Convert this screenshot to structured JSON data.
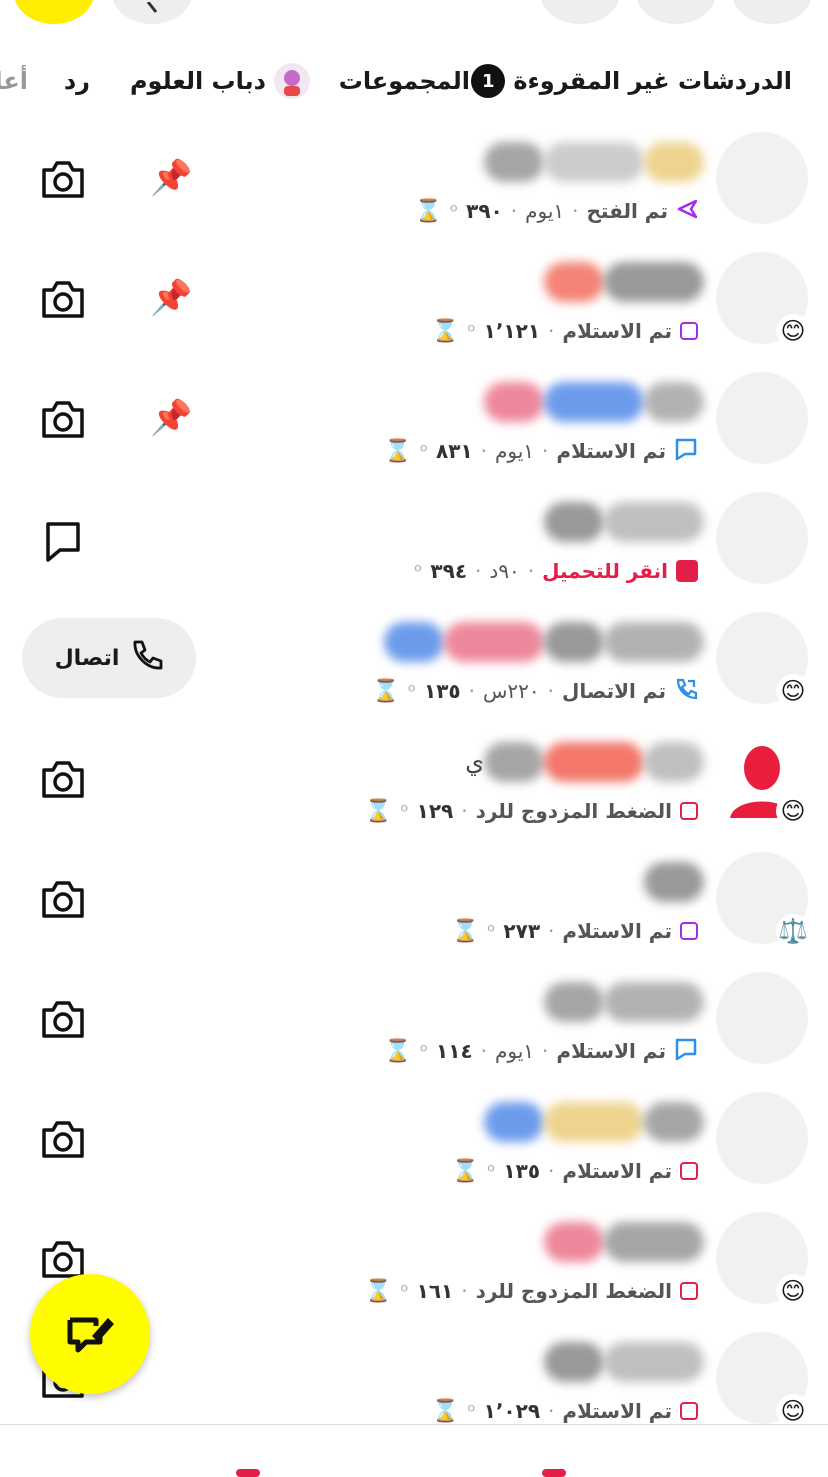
{
  "tabs": [
    {
      "label": "الدردشات غير المقروءة",
      "badge": "1"
    },
    {
      "label": "المجموعات"
    },
    {
      "label": "دباب العلوم"
    },
    {
      "label": "رد"
    },
    {
      "label": "أعا"
    }
  ],
  "chats": [
    {
      "name": "",
      "status": "تم الفتح",
      "status_icon": "sent-arrow-icon",
      "status_color": "#a12ee8",
      "time": "١يوم",
      "streak": "٣٩٠",
      "hourglass": true,
      "emoji": "",
      "action": "camera",
      "pinned": true,
      "blobs": [
        "#888",
        "#bbb",
        "#e9c56a"
      ]
    },
    {
      "name": "",
      "status": "تم الاستلام",
      "status_icon": "square-icon",
      "status_color": "#a12ee8",
      "time": "",
      "streak": "١٬١٢١",
      "hourglass": true,
      "emoji": "😊",
      "action": "camera",
      "pinned": true,
      "blobs": [
        "#ef5a48",
        "#777"
      ]
    },
    {
      "name": "",
      "status": "تم الاستلام",
      "status_icon": "chat-bubble-icon",
      "status_color": "#2e8ee8",
      "time": "١يوم",
      "streak": "٨٣١",
      "hourglass": true,
      "emoji": "",
      "action": "camera",
      "pinned": true,
      "blobs": [
        "#e8607a",
        "#3d7ae6",
        "#999"
      ]
    },
    {
      "name": "",
      "status": "انقر للتحميل",
      "status_icon": "filled-square-icon",
      "status_color": "#e21f48",
      "time": "٩٠د",
      "streak": "٣٩٤",
      "hourglass": false,
      "emoji": "",
      "action": "chat",
      "pinned": false,
      "blobs": [
        "#777",
        "#aaa"
      ]
    },
    {
      "name": "",
      "status": "تم الاتصال",
      "status_icon": "call-return-icon",
      "status_color": "#2e8ee8",
      "time": "٢٢٠س",
      "streak": "١٣٥",
      "hourglass": true,
      "emoji": "😊",
      "action": "call",
      "pinned": false,
      "blobs": [
        "#3d7ae6",
        "#e8607a",
        "#777",
        "#999"
      ]
    },
    {
      "name": "ي",
      "status": "الضغط المزدوج للرد",
      "status_icon": "square-icon",
      "status_color": "#e21f48",
      "time": "",
      "streak": "١٢٩",
      "hourglass": true,
      "emoji": "😊",
      "action": "camera",
      "pinned": false,
      "blobs": [
        "#888",
        "#ef4a3a",
        "#aaa"
      ],
      "red_avatar": true
    },
    {
      "name": "",
      "status": "تم الاستلام",
      "status_icon": "square-icon",
      "status_color": "#a12ee8",
      "time": "",
      "streak": "٢٧٣",
      "hourglass": true,
      "emoji": "⚖️",
      "action": "camera",
      "pinned": false,
      "blobs": [
        "#777"
      ]
    },
    {
      "name": "",
      "status": "تم الاستلام",
      "status_icon": "chat-bubble-icon",
      "status_color": "#2e8ee8",
      "time": "١يوم",
      "streak": "١١٤",
      "hourglass": true,
      "emoji": "",
      "action": "camera",
      "pinned": false,
      "blobs": [
        "#888",
        "#999"
      ]
    },
    {
      "name": "",
      "status": "تم الاستلام",
      "status_icon": "square-icon",
      "status_color": "#e21f48",
      "time": "",
      "streak": "١٣٥",
      "hourglass": true,
      "emoji": "",
      "action": "camera",
      "pinned": false,
      "blobs": [
        "#3d7ae6",
        "#e9c56a",
        "#888"
      ]
    },
    {
      "name": "",
      "status": "الضغط المزدوج للرد",
      "status_icon": "square-icon",
      "status_color": "#e21f48",
      "time": "",
      "streak": "١٦١",
      "hourglass": true,
      "emoji": "😊",
      "action": "camera",
      "pinned": false,
      "blobs": [
        "#e8607a",
        "#888"
      ]
    },
    {
      "name": "",
      "status": "تم الاستلام",
      "status_icon": "square-icon",
      "status_color": "#e21f48",
      "time": "",
      "streak": "١٬٠٢٩",
      "hourglass": true,
      "emoji": "😊",
      "action": "camera",
      "pinned": false,
      "blobs": [
        "#777",
        "#aaa"
      ]
    }
  ],
  "call_label": "اتصال",
  "streak_icon": "snap-streak-icon",
  "colors": {
    "accent": "#fffc00",
    "unread": "#e21f48",
    "purple": "#a12ee8",
    "blue": "#2e8ee8"
  }
}
